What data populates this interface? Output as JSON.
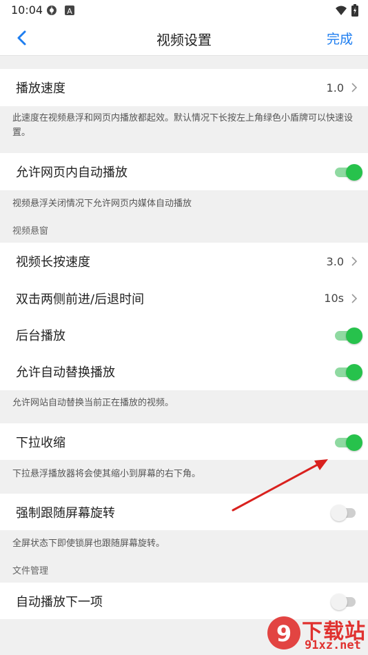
{
  "status_bar": {
    "time": "10:04",
    "icons": [
      "settings-gear-icon",
      "a-letter-icon",
      "wifi-icon",
      "battery-charging-icon"
    ]
  },
  "nav": {
    "title": "视频设置",
    "done_label": "完成",
    "accent_color": "#1e7ef0"
  },
  "settings": {
    "playback_speed": {
      "label": "播放速度",
      "value": "1.0"
    },
    "playback_speed_note": "此速度在视频悬浮和网页内播放都起效。默认情况下长按左上角绿色小盾牌可以快速设置。",
    "allow_inline_autoplay": {
      "label": "允许网页内自动播放",
      "enabled": true
    },
    "allow_inline_autoplay_note": "视频悬浮关闭情况下允许网页内媒体自动播放",
    "section_float": "视频悬窗",
    "long_press_speed": {
      "label": "视频长按速度",
      "value": "3.0"
    },
    "double_tap_seek": {
      "label": "双击两侧前进/后退时间",
      "value": "10s"
    },
    "background_play": {
      "label": "后台播放",
      "enabled": true
    },
    "auto_replace": {
      "label": "允许自动替换播放",
      "enabled": true
    },
    "auto_replace_note": "允许网站自动替换当前正在播放的视频。",
    "pull_down_shrink": {
      "label": "下拉收缩",
      "enabled": true
    },
    "pull_down_shrink_note": "下拉悬浮播放器将会使其缩小到屏幕的右下角。",
    "force_rotation": {
      "label": "强制跟随屏幕旋转",
      "enabled": false
    },
    "force_rotation_note": "全屏状态下即使锁屏也跟随屏幕旋转。",
    "section_files": "文件管理",
    "autoplay_next": {
      "label": "自动播放下一项",
      "enabled": false
    }
  },
  "toggle_colors": {
    "on": "#27c24c",
    "off": "#f2f2f2"
  },
  "watermark": {
    "line1": "下载站",
    "line2": "91xz.net",
    "badge": "9"
  }
}
